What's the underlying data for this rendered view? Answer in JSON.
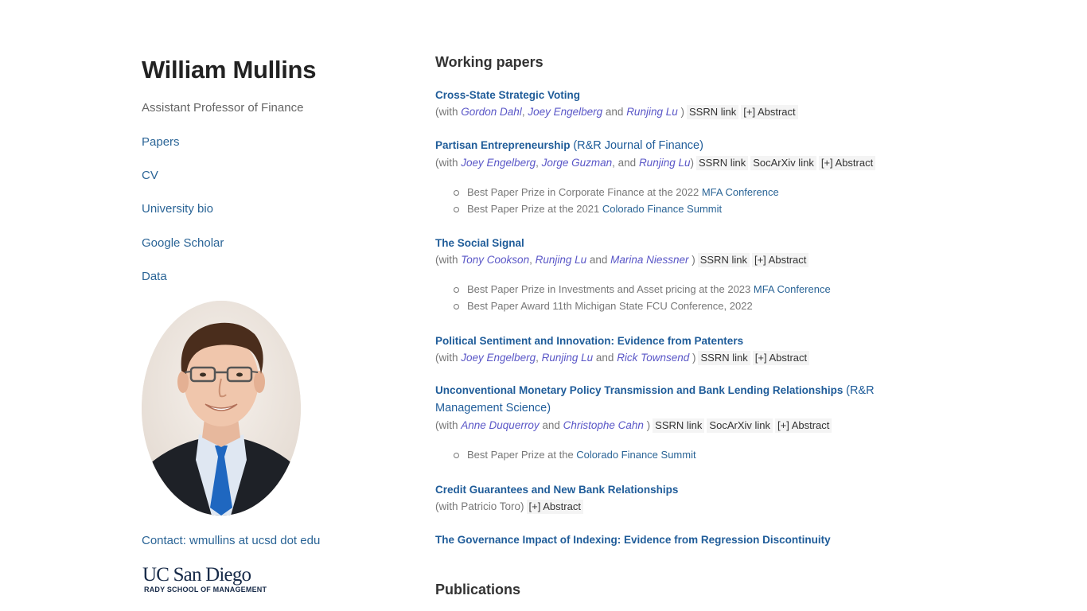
{
  "profile": {
    "name": "William Mullins",
    "role": "Assistant Professor of Finance",
    "nav": [
      "Papers",
      "CV",
      "University bio",
      "Google Scholar",
      "Data"
    ],
    "contact": "Contact: wmullins at ucsd dot edu",
    "logo_line1": "UC San Diego",
    "logo_line2": "RADY SCHOOL OF MANAGEMENT"
  },
  "sections": {
    "working_papers": "Working papers",
    "publications": "Publications"
  },
  "papers": [
    {
      "title": "Cross-State Strategic Voting",
      "note": "",
      "with": "(with ",
      "coauthors": [
        "Gordon Dahl",
        "Joey Engelberg",
        "Runjing Lu"
      ],
      "sep": [
        ", ",
        " and "
      ],
      "close": " )",
      "buttons": [
        "SSRN link",
        "[+] Abstract"
      ],
      "awards": []
    },
    {
      "title": "Partisan Entrepreneurship",
      "note": "(R&R Journal of Finance)",
      "with": "(with ",
      "coauthors": [
        "Joey Engelberg",
        "Jorge Guzman",
        "Runjing Lu"
      ],
      "sep": [
        ", ",
        ", and "
      ],
      "close": ")",
      "buttons": [
        "SSRN link",
        "SocArXiv link",
        "[+] Abstract"
      ],
      "awards": [
        {
          "text": "Best Paper Prize in Corporate Finance at the 2022 ",
          "link": "MFA Conference"
        },
        {
          "text": "Best Paper Prize at the 2021 ",
          "link": "Colorado Finance Summit"
        }
      ]
    },
    {
      "title": "The Social Signal",
      "note": "",
      "with": "(with ",
      "coauthors": [
        "Tony Cookson",
        "Runjing Lu",
        "Marina Niessner"
      ],
      "sep": [
        ", ",
        " and "
      ],
      "close": " )",
      "buttons": [
        "SSRN link",
        "[+] Abstract"
      ],
      "awards": [
        {
          "text": "Best Paper Prize in Investments and Asset pricing at the 2023 ",
          "link": "MFA Conference"
        },
        {
          "text": "Best Paper Award 11th Michigan State FCU Conference, 2022",
          "link": ""
        }
      ]
    },
    {
      "title": "Political Sentiment and Innovation: Evidence from Patenters",
      "note": "",
      "with": "(with ",
      "coauthors": [
        "Joey Engelberg",
        "Runjing Lu",
        "Rick Townsend"
      ],
      "sep": [
        ", ",
        " and "
      ],
      "close": " )",
      "buttons": [
        "SSRN link",
        "[+] Abstract"
      ],
      "awards": []
    },
    {
      "title": "Unconventional Monetary Policy Transmission and Bank Lending Relationships",
      "note": "(R&R Management Science)",
      "with": "(with ",
      "coauthors": [
        "Anne Duquerroy",
        "Christophe Cahn"
      ],
      "sep": [
        " and "
      ],
      "close": " )",
      "buttons": [
        "SSRN link",
        "SocArXiv link",
        "[+] Abstract"
      ],
      "awards": [
        {
          "text": "Best Paper Prize at the ",
          "link": "Colorado Finance Summit"
        }
      ]
    },
    {
      "title": "Credit Guarantees and New Bank Relationships",
      "note": "",
      "with": "(with Patricio Toro)",
      "coauthors": [],
      "sep": [],
      "close": "",
      "buttons": [
        "[+] Abstract"
      ],
      "awards": []
    },
    {
      "title": "The Governance Impact of Indexing: Evidence from Regression Discontinuity",
      "note": "",
      "with": "",
      "coauthors": [],
      "sep": [],
      "close": "",
      "buttons": [],
      "awards": []
    }
  ]
}
